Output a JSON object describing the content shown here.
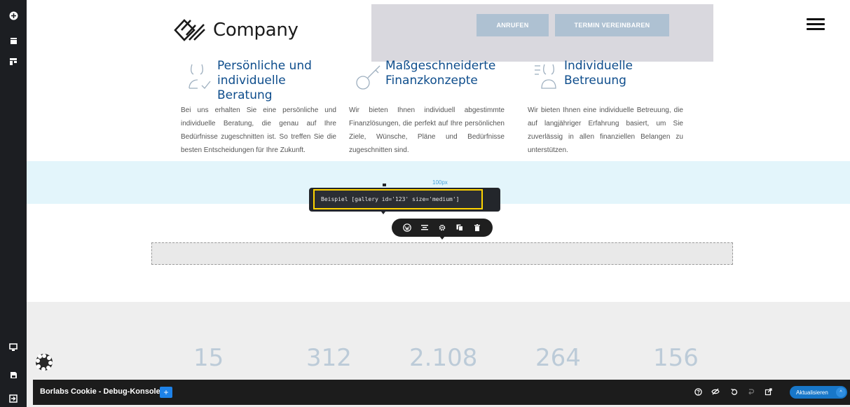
{
  "header": {
    "logo_text": "Company",
    "call_button": "ANRUFEN",
    "appointment_button": "TERMIN VEREINBAREN"
  },
  "features": [
    {
      "title": "Persönliche und individuelle Beratung",
      "text": "Bei uns erhalten Sie eine persönliche und individuelle Beratung, die genau auf Ihre Bedürfnisse zugeschnitten ist. So treffen Sie die besten Entscheidungen für Ihre Zukunft."
    },
    {
      "title": "Maßgeschneiderte Finanzkonzepte",
      "text": "Wir bieten Ihnen individuell abgestimmte Finanzlösungen, die perfekt auf Ihre persönlichen Ziele, Wünsche, Pläne und Bedürfnisse zugeschnitten sind."
    },
    {
      "title": "Individuelle Betreuung",
      "text": "Wir bieten Ihnen eine individuelle Betreuung, die auf langjähriger Erfahrung basiert, um Sie zuverlässig in allen finanziellen Belangen zu unterstützen."
    }
  ],
  "editor": {
    "spacer_label": "100px",
    "shortcode_value": "Beispiel [gallery id='123' size='medium']"
  },
  "stats": [
    "15",
    "312",
    "2.108",
    "264",
    "156"
  ],
  "debug_bar": {
    "title": "Borlabs Cookie - Debug-Konsole",
    "add_label": "+",
    "update_label": "Aktualisieren"
  },
  "colors": {
    "brand_blue": "#0e4d8c",
    "stat_color": "#bccbd8",
    "band_color": "#e3f5fb",
    "highlight": "#ffd400"
  }
}
